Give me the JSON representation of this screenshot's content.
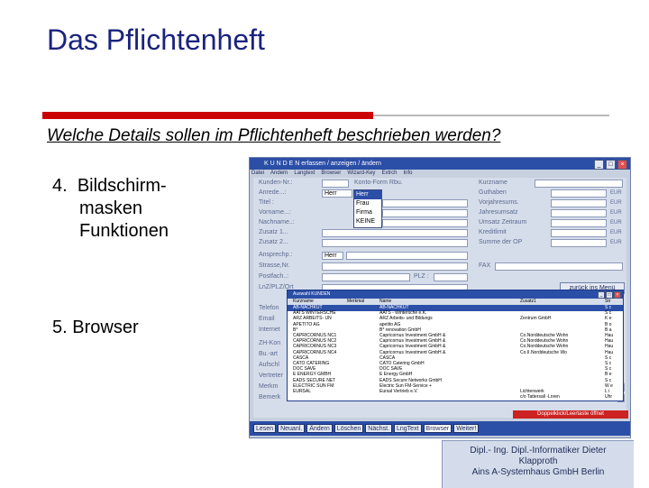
{
  "slide": {
    "title": "Das Pflichtenheft",
    "question": "Welche Details sollen im Pflichtenheft beschrieben werden?",
    "bullet4": {
      "number": "4.",
      "lines": [
        "Bildschirm-",
        "masken",
        "Funktionen"
      ]
    },
    "bullet5": {
      "number": "5.",
      "text": "Browser"
    },
    "footer": [
      "Dipl.- Ing. Dipl.-Informatiker Dieter",
      "Klapproth",
      "Ains A-Systemhaus GmbH  Berlin"
    ]
  },
  "app": {
    "title": "K U N D E N   erfassen / anzeigen / ändern",
    "menu": [
      "Datei",
      "Ändern",
      "Langtext",
      "Browser",
      "Wizard-Key",
      "Extrch",
      "Info"
    ],
    "left_labels": [
      "Kunden-Nr.:",
      "Anrede...:",
      "Titel :",
      "Vorname...:",
      "Nachname..:",
      "Zusatz 1...",
      "Zusatz 2...",
      "Ansprechp.:",
      "Strasse,Nr.",
      "Postfach..:",
      "LnZ/PLZ/Ort",
      "Telefon",
      "Email",
      "Internet",
      "ZH-Kon",
      "Bu.-art",
      "Aufschl",
      "Vertreter",
      "Merkm",
      "Bemerk"
    ],
    "anrede_value": "Herr",
    "ansprech_value": "Herr",
    "anrede_options": [
      "Herr",
      "Frau",
      "Firma",
      "KEINE"
    ],
    "kontoform_label": "Konto-Form Rbu.",
    "plz_label": "PLZ :",
    "right_labels": [
      "Kurzname",
      "Guthaben",
      "Vorjahresums.",
      "Jahresumsatz",
      "Umsatz Zeitraum",
      "Kreditlimit",
      "Summe der OP",
      "FAX"
    ],
    "currency": "EUR",
    "zurueck_label": "zurück ins Menü",
    "status": "Doppelklick/Leertaste öffnet",
    "buttons": [
      "Lesen",
      "Neuanl.",
      "Ändern",
      "Löschen",
      "Nächst.",
      "LngText",
      "Browser",
      "Weiter!"
    ],
    "active_button": "Browser"
  },
  "browser": {
    "title": "Auswahl KUNDEN",
    "columns": [
      "Kurzname",
      "Merkmal",
      "Name",
      "Zusatz1",
      "Str"
    ],
    "rows": [
      [
        "AB-NACHKUT",
        "",
        "AB-NACHKUT",
        "",
        "S c"
      ],
      [
        "AATS WINTERSCHE",
        "",
        "AATS - Wintersche  e.K.",
        "",
        "S c"
      ],
      [
        "ARZ ARBEITS- UN",
        "",
        "ARZ Arbeits- und Bildungs",
        "Zentrum GmbH",
        "K e"
      ],
      [
        "APETITO AG",
        "",
        "apetito AG",
        "",
        "B o"
      ],
      [
        "B*",
        "",
        "B* renovation GmbH",
        "",
        "B a"
      ],
      [
        "CAPRICORNUS NC1",
        "",
        "Capricornus Investment GmbH &",
        "Co.Norddeutsche Wohn",
        "Hau"
      ],
      [
        "CAPRICORNUS NC2",
        "",
        "Capricornus Investment GmbH &",
        "Co.Norddeutsche Wohn",
        "Hau"
      ],
      [
        "CAPRICORNUS NC3",
        "",
        "Capricornus Investment GmbH &",
        "Co.Norddeutsche Wohn",
        "Hau"
      ],
      [
        "CAPRICORNUS NC4",
        "",
        "Capricornus Investment GmbH &",
        "Co.II.Norddeutsche Wo",
        "Hau"
      ],
      [
        "CASCA",
        "",
        "CASCA",
        "",
        "S c"
      ],
      [
        "CATO CATERING",
        "",
        "CATO Catering GmbH",
        "",
        "S c"
      ],
      [
        "DOC SAVE",
        "",
        "DOC SAVE",
        "",
        "S c"
      ],
      [
        "E ENERGY GMBH",
        "",
        "E Energy GmbH",
        "",
        "B e"
      ],
      [
        "EADS SECURE NET",
        "",
        "EADS Secure Networks GmbH",
        "",
        "S c"
      ],
      [
        "ELECTRIC SUN FM",
        "",
        "Electric Sun FM-Service +",
        "",
        "W e"
      ],
      [
        "EURSAL",
        "",
        "Eursal Vertrieb e.V.",
        "Lichtenwerk",
        "L i"
      ],
      [
        "",
        "",
        "",
        "c/o Tattersall -Loren",
        "Uhr"
      ]
    ]
  }
}
